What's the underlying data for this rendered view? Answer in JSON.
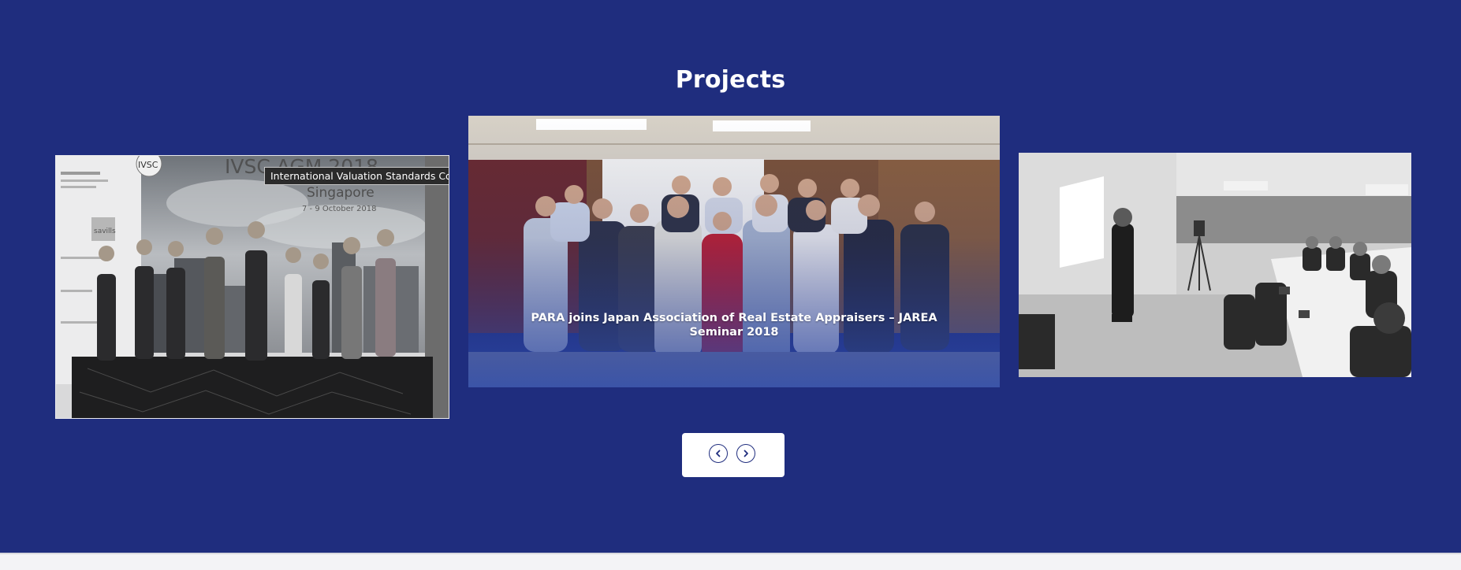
{
  "section": {
    "title": "Projects",
    "background_color": "#1f2d7e"
  },
  "slides": [
    {
      "tooltip": "International Valuation Standards Council PARA",
      "photo_text": {
        "logo": "IVSC",
        "event": "IVSC AGM 2018",
        "city": "Singapore",
        "dates": "7 - 9 October 2018",
        "sponsor": "savills"
      }
    },
    {
      "caption": "PARA joins Japan Association of Real Estate Appraisers – JAREA Seminar 2018"
    },
    {
      "caption": ""
    }
  ],
  "navigation": {
    "prev_icon": "chevron-left-icon",
    "next_icon": "chevron-right-icon"
  }
}
